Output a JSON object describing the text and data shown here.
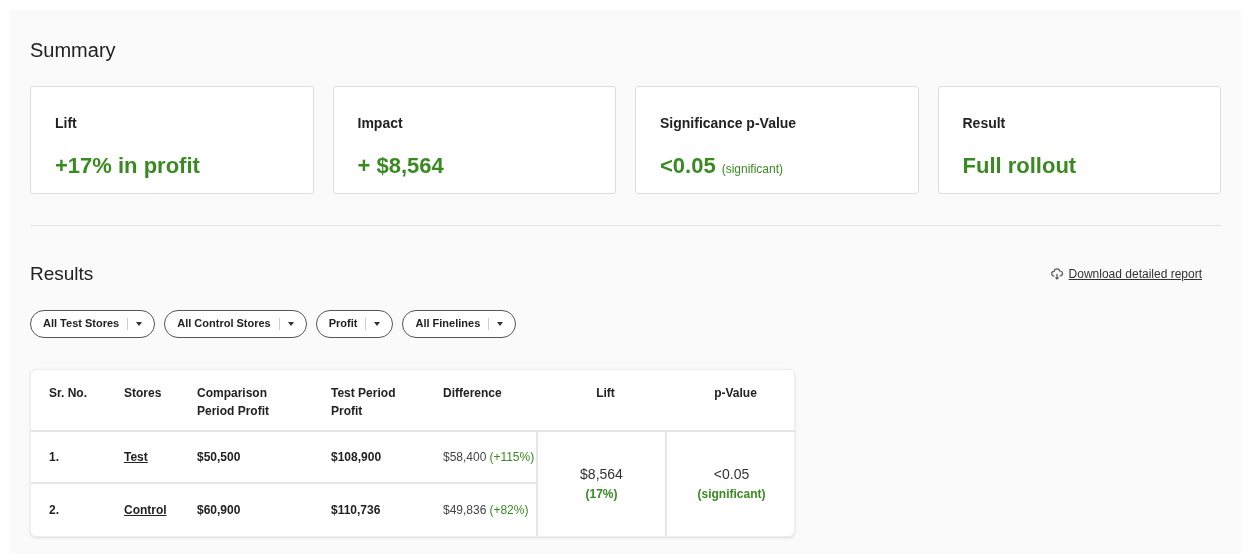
{
  "summary": {
    "title": "Summary",
    "cards": [
      {
        "label": "Lift",
        "value": "+17% in profit"
      },
      {
        "label": "Impact",
        "value": "+ $8,564"
      },
      {
        "label": "Significance p-Value",
        "value": "<0.05",
        "note": "(significant)"
      },
      {
        "label": "Result",
        "value": "Full rollout"
      }
    ]
  },
  "results": {
    "title": "Results",
    "download_link": "Download detailed report",
    "filters": [
      "All Test Stores",
      "All Control Stores",
      "Profit",
      "All Finelines"
    ],
    "table": {
      "columns": [
        "Sr. No.",
        "Stores",
        "Comparison Period Profit",
        "Test Period Profit",
        "Difference",
        "Lift",
        "p-Value"
      ],
      "rows": [
        {
          "sr": "1.",
          "store": "Test",
          "comparison": "$50,500",
          "test": "$108,900",
          "difference": "$58,400",
          "change": "(+115%)"
        },
        {
          "sr": "2.",
          "store": "Control",
          "comparison": "$60,900",
          "test": "$110,736",
          "difference": "$49,836",
          "change": "(+82%)"
        }
      ],
      "lift": {
        "value": "$8,564",
        "percent": "(17%)"
      },
      "p_value": {
        "value": "<0.05",
        "note": "(significant)"
      }
    }
  }
}
